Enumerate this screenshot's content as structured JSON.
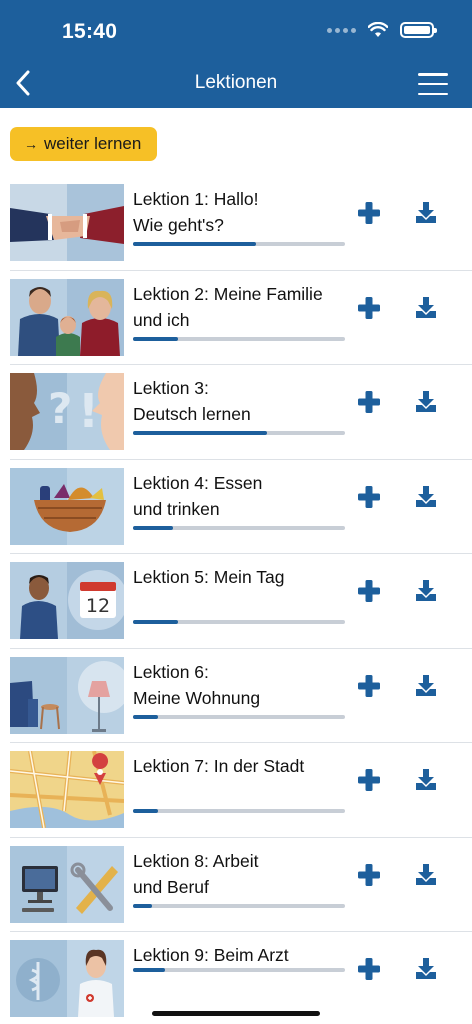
{
  "status": {
    "time": "15:40"
  },
  "header": {
    "title": "Lektionen"
  },
  "continue_button": {
    "label": "weiter lernen",
    "arrow": "→"
  },
  "colors": {
    "brand": "#1d5f9c",
    "accent": "#f6c026",
    "track": "#c8ced6"
  },
  "lessons": [
    {
      "title": "Lektion 1: Hallo!\nWie geht's?",
      "progress": 0.58,
      "image": "handshake-image"
    },
    {
      "title": "Lektion 2: Meine Familie\nund ich",
      "progress": 0.21,
      "image": "family-image"
    },
    {
      "title": "Lektion 3:\nDeutsch lernen",
      "progress": 0.63,
      "image": "question-marks-image"
    },
    {
      "title": "Lektion 4: Essen\nund trinken",
      "progress": 0.19,
      "image": "food-basket-image"
    },
    {
      "title": "Lektion 5: Mein Tag",
      "progress": 0.21,
      "image": "calendar-image"
    },
    {
      "title": "Lektion 6:\nMeine Wohnung",
      "progress": 0.12,
      "image": "living-room-image"
    },
    {
      "title": "Lektion 7: In der Stadt",
      "progress": 0.12,
      "image": "city-map-image"
    },
    {
      "title": "Lektion 8: Arbeit\nund Beruf",
      "progress": 0.09,
      "image": "work-tools-image"
    },
    {
      "title": "Lektion 9: Beim Arzt",
      "progress": 0.15,
      "image": "doctor-image"
    }
  ],
  "icons": {
    "add": "plus-icon",
    "download": "download-icon",
    "back": "chevron-left-icon",
    "menu": "hamburger-menu-icon"
  }
}
